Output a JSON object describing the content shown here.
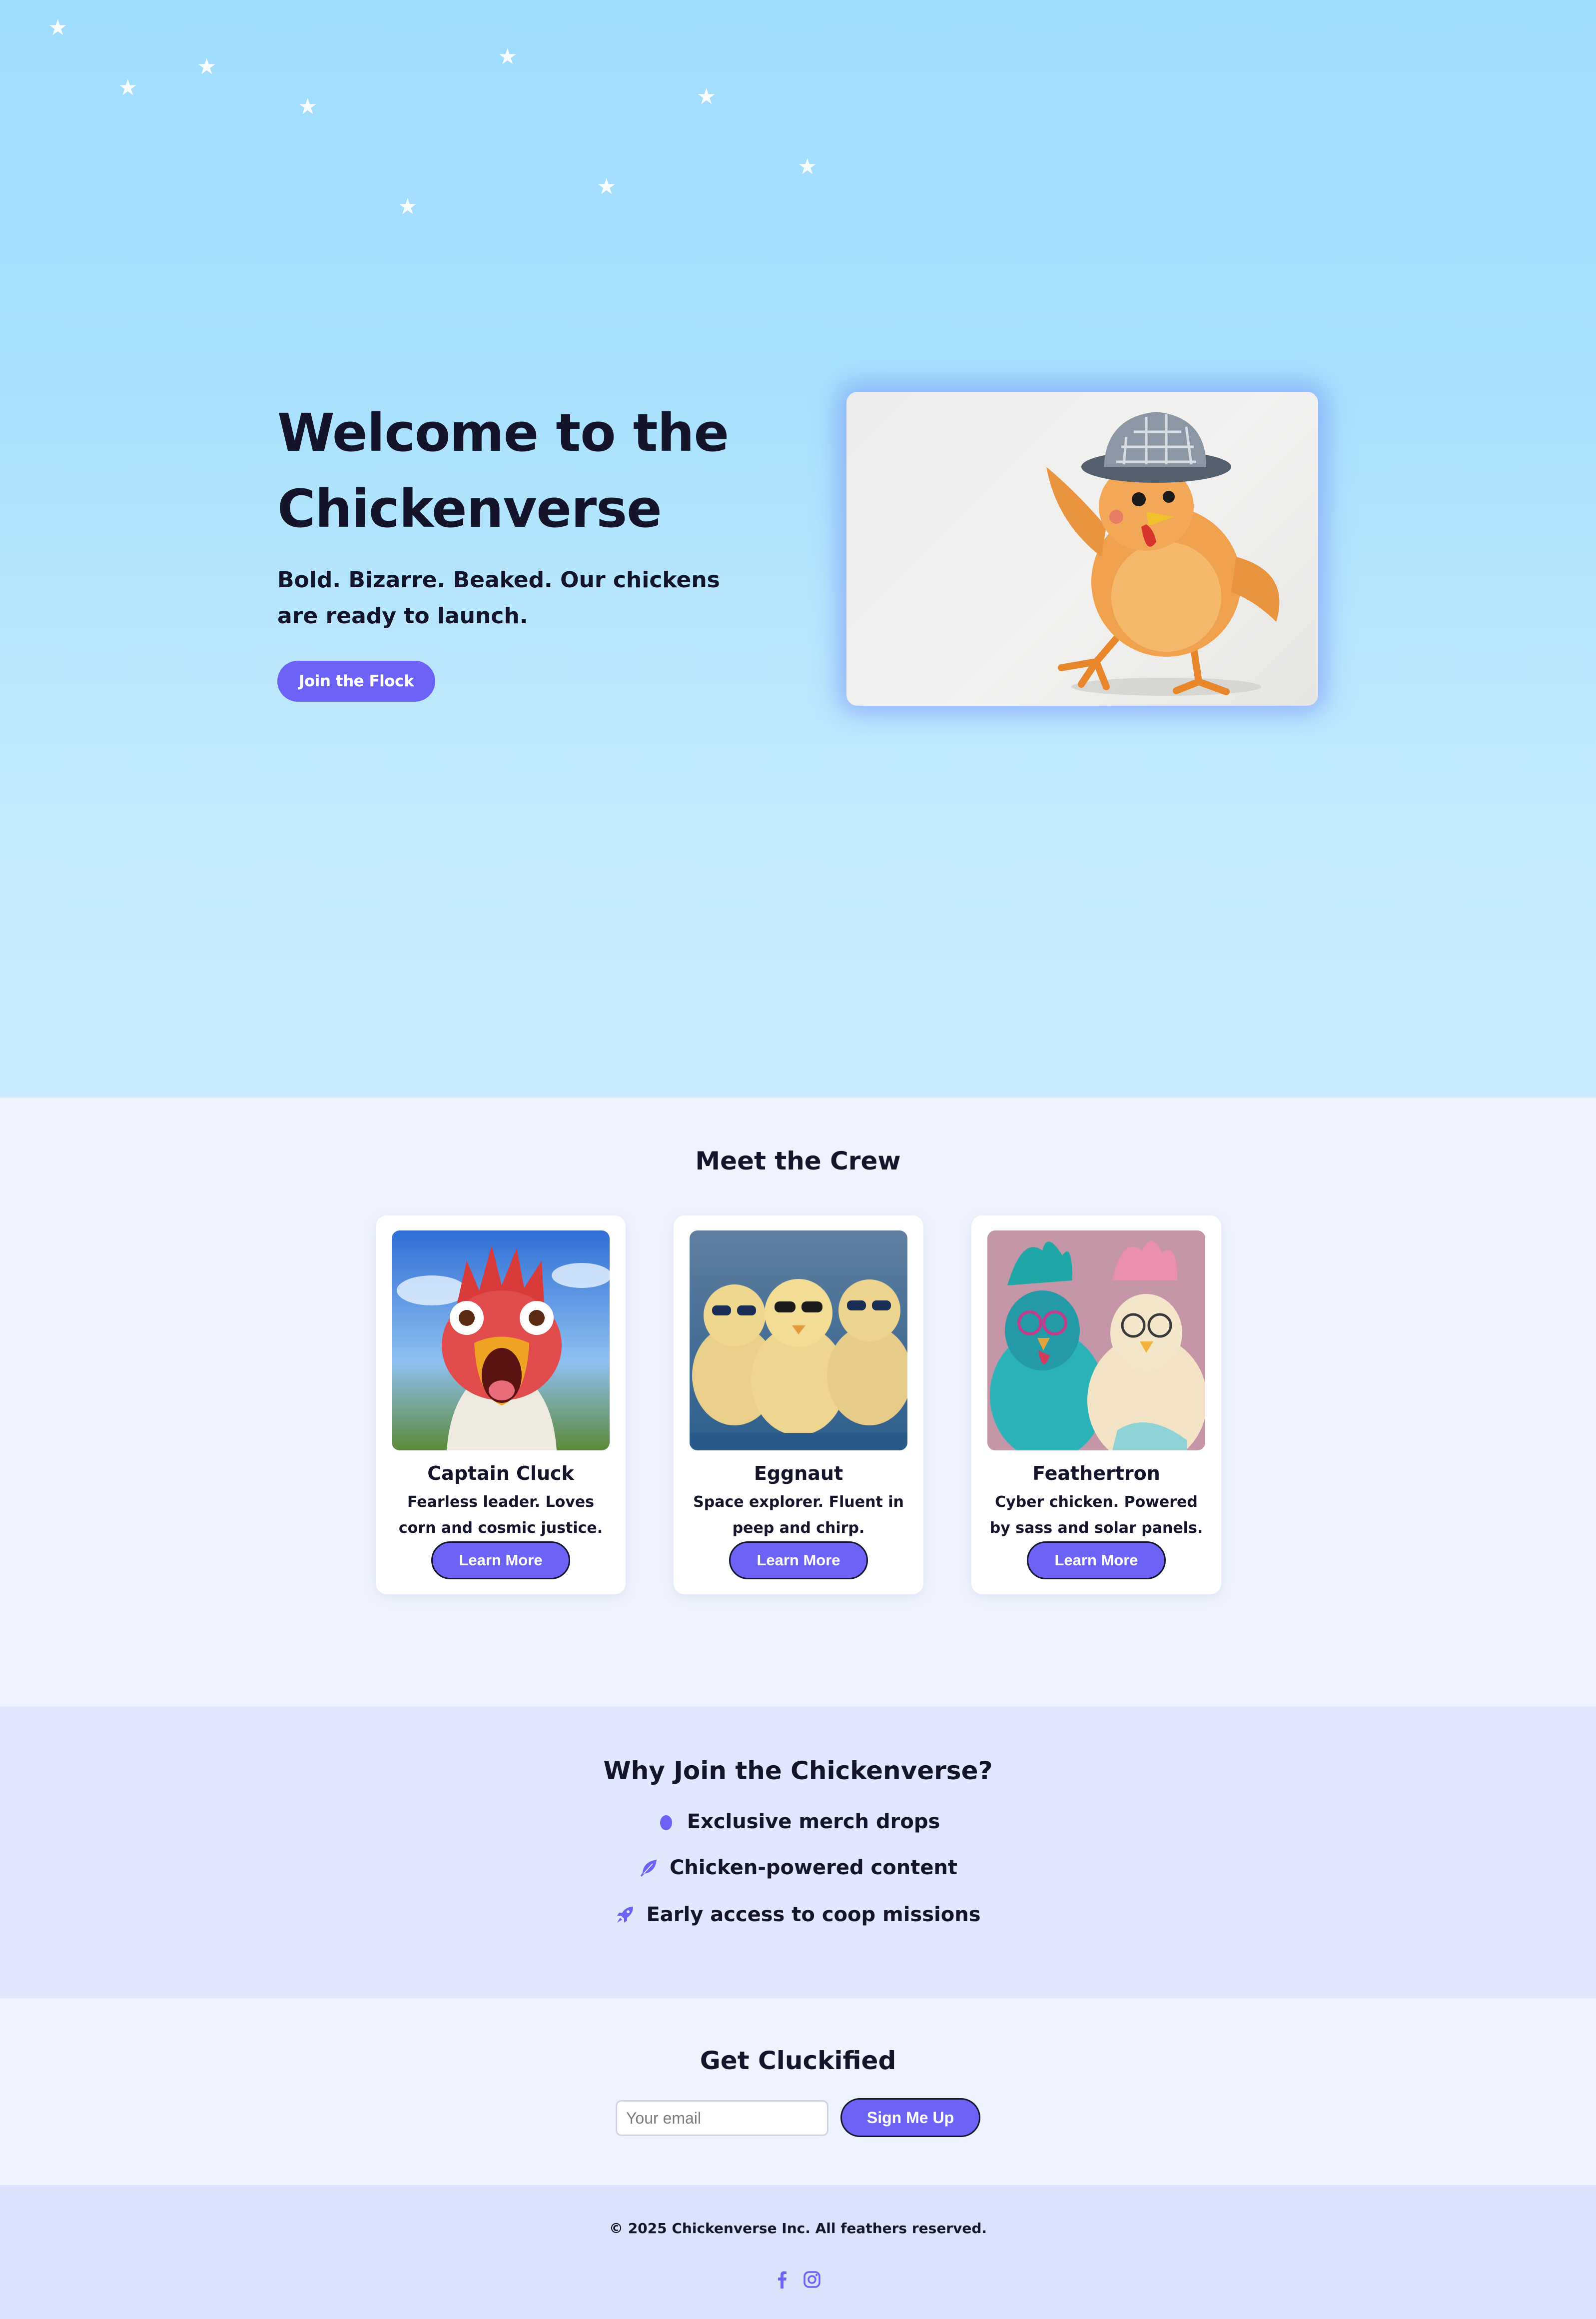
{
  "hero": {
    "title_line1": "Welcome to the",
    "title_line2": "Chickenverse",
    "subtitle": "Bold. Bizarre. Beaked. Our chickens are ready to launch.",
    "cta_label": "Join the Flock",
    "image_icon": "disco-chicken-image",
    "star_icon": "★"
  },
  "crew": {
    "title": "Meet the Crew",
    "members": [
      {
        "name": "Captain Cluck",
        "description": "Fearless leader. Loves corn and cosmic justice.",
        "button": "Learn More",
        "image_icon": "screaming-rooster-image"
      },
      {
        "name": "Eggnaut",
        "description": "Space explorer. Fluent in peep and chirp.",
        "button": "Learn More",
        "image_icon": "chicks-sunglasses-image"
      },
      {
        "name": "Feathertron",
        "description": "Cyber chicken. Powered by sass and solar panels.",
        "button": "Learn More",
        "image_icon": "two-punk-chickens-image"
      }
    ]
  },
  "why": {
    "title": "Why Join the Chickenverse?",
    "items": [
      {
        "icon": "egg-icon",
        "text": "Exclusive merch drops"
      },
      {
        "icon": "feather-icon",
        "text": "Chicken-powered content"
      },
      {
        "icon": "rocket-icon",
        "text": "Early access to coop missions"
      }
    ]
  },
  "signup": {
    "title": "Get Cluckified",
    "email_placeholder": "Your email",
    "button": "Sign Me Up"
  },
  "footer": {
    "copyright": "© 2025 Chickenverse Inc. All feathers reserved.",
    "social": [
      "facebook-icon",
      "instagram-icon"
    ]
  },
  "colors": {
    "accent": "#6c63f6",
    "text": "#14142b",
    "hero_sky_top": "#a0dcfc",
    "hero_sky_bottom": "#c8ecfe",
    "crew_bg": "#eff3fe",
    "why_bg": "#e1e7fc",
    "footer_bg": "#dae2fc"
  }
}
